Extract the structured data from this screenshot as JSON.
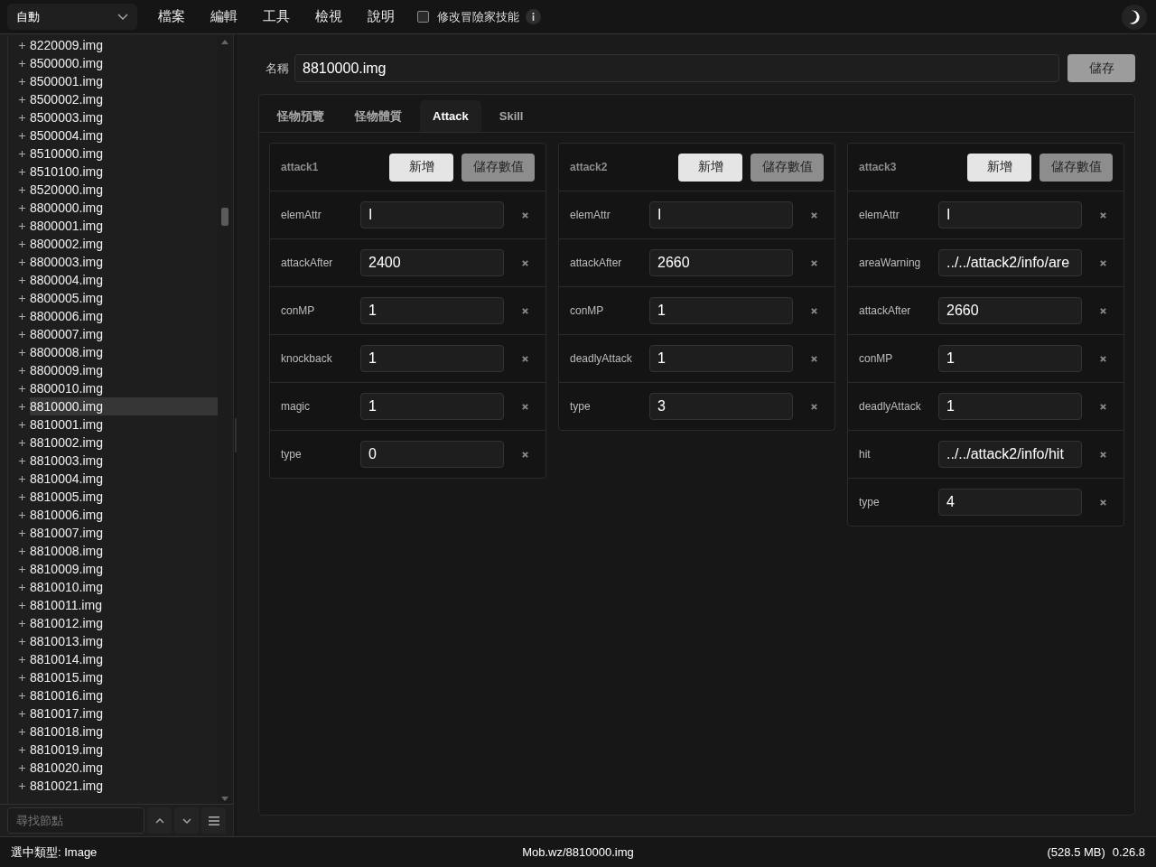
{
  "toolbar": {
    "mode_select": {
      "value": "自動"
    },
    "menu": [
      "檔案",
      "編輯",
      "工具",
      "檢視",
      "說明"
    ],
    "option": {
      "label": "修改冒險家技能",
      "checked": false
    }
  },
  "tree": {
    "items": [
      {
        "label": "8220009.img",
        "expanded": false,
        "selected": false
      },
      {
        "label": "8500000.img",
        "expanded": false,
        "selected": false
      },
      {
        "label": "8500001.img",
        "expanded": false,
        "selected": false
      },
      {
        "label": "8500002.img",
        "expanded": false,
        "selected": false
      },
      {
        "label": "8500003.img",
        "expanded": false,
        "selected": false
      },
      {
        "label": "8500004.img",
        "expanded": false,
        "selected": false
      },
      {
        "label": "8510000.img",
        "expanded": false,
        "selected": false
      },
      {
        "label": "8510100.img",
        "expanded": false,
        "selected": false
      },
      {
        "label": "8520000.img",
        "expanded": false,
        "selected": false
      },
      {
        "label": "8800000.img",
        "expanded": false,
        "selected": false
      },
      {
        "label": "8800001.img",
        "expanded": false,
        "selected": false
      },
      {
        "label": "8800002.img",
        "expanded": false,
        "selected": false
      },
      {
        "label": "8800003.img",
        "expanded": false,
        "selected": false
      },
      {
        "label": "8800004.img",
        "expanded": false,
        "selected": false
      },
      {
        "label": "8800005.img",
        "expanded": false,
        "selected": false
      },
      {
        "label": "8800006.img",
        "expanded": false,
        "selected": false
      },
      {
        "label": "8800007.img",
        "expanded": false,
        "selected": false
      },
      {
        "label": "8800008.img",
        "expanded": false,
        "selected": false
      },
      {
        "label": "8800009.img",
        "expanded": false,
        "selected": false
      },
      {
        "label": "8800010.img",
        "expanded": false,
        "selected": false
      },
      {
        "label": "8810000.img",
        "expanded": false,
        "selected": true
      },
      {
        "label": "8810001.img",
        "expanded": false,
        "selected": false
      },
      {
        "label": "8810002.img",
        "expanded": false,
        "selected": false
      },
      {
        "label": "8810003.img",
        "expanded": false,
        "selected": false
      },
      {
        "label": "8810004.img",
        "expanded": false,
        "selected": false
      },
      {
        "label": "8810005.img",
        "expanded": false,
        "selected": false
      },
      {
        "label": "8810006.img",
        "expanded": false,
        "selected": false
      },
      {
        "label": "8810007.img",
        "expanded": false,
        "selected": false
      },
      {
        "label": "8810008.img",
        "expanded": false,
        "selected": false
      },
      {
        "label": "8810009.img",
        "expanded": false,
        "selected": false
      },
      {
        "label": "8810010.img",
        "expanded": false,
        "selected": false
      },
      {
        "label": "8810011.img",
        "expanded": false,
        "selected": false
      },
      {
        "label": "8810012.img",
        "expanded": false,
        "selected": false
      },
      {
        "label": "8810013.img",
        "expanded": false,
        "selected": false
      },
      {
        "label": "8810014.img",
        "expanded": false,
        "selected": false
      },
      {
        "label": "8810015.img",
        "expanded": false,
        "selected": false
      },
      {
        "label": "8810016.img",
        "expanded": false,
        "selected": false
      },
      {
        "label": "8810017.img",
        "expanded": false,
        "selected": false
      },
      {
        "label": "8810018.img",
        "expanded": false,
        "selected": false
      },
      {
        "label": "8810019.img",
        "expanded": false,
        "selected": false
      },
      {
        "label": "8810020.img",
        "expanded": false,
        "selected": false
      },
      {
        "label": "8810021.img",
        "expanded": false,
        "selected": false
      }
    ]
  },
  "node_search": {
    "placeholder": "尋找節點"
  },
  "editor": {
    "name_label": "名稱",
    "name_value": "8810000.img",
    "save_button": {
      "label": "儲存",
      "kind": "secondary"
    },
    "tabs": [
      {
        "label": "怪物預覽",
        "selected": false
      },
      {
        "label": "怪物體質",
        "selected": false
      },
      {
        "label": "Attack",
        "selected": true
      },
      {
        "label": "Skill",
        "selected": false
      }
    ],
    "groups": [
      {
        "title": "attack1",
        "buttons": [
          {
            "label": "新增",
            "kind": "primary"
          },
          {
            "label": "儲存數值",
            "kind": "secondary"
          }
        ],
        "fields": [
          {
            "key": "elemAttr",
            "value": "I"
          },
          {
            "key": "attackAfter",
            "value": "2400"
          },
          {
            "key": "conMP",
            "value": "1"
          },
          {
            "key": "knockback",
            "value": "1"
          },
          {
            "key": "magic",
            "value": "1"
          },
          {
            "key": "type",
            "value": "0"
          }
        ]
      },
      {
        "title": "attack2",
        "buttons": [
          {
            "label": "新增",
            "kind": "primary"
          },
          {
            "label": "儲存數值",
            "kind": "secondary"
          }
        ],
        "fields": [
          {
            "key": "elemAttr",
            "value": "I"
          },
          {
            "key": "attackAfter",
            "value": "2660"
          },
          {
            "key": "conMP",
            "value": "1"
          },
          {
            "key": "deadlyAttack",
            "value": "1"
          },
          {
            "key": "type",
            "value": "3"
          }
        ]
      },
      {
        "title": "attack3",
        "buttons": [
          {
            "label": "新增",
            "kind": "primary"
          },
          {
            "label": "儲存數值",
            "kind": "secondary"
          }
        ],
        "fields": [
          {
            "key": "elemAttr",
            "value": "I"
          },
          {
            "key": "areaWarning",
            "value": "../../attack2/info/are"
          },
          {
            "key": "attackAfter",
            "value": "2660"
          },
          {
            "key": "conMP",
            "value": "1"
          },
          {
            "key": "deadlyAttack",
            "value": "1"
          },
          {
            "key": "hit",
            "value": "../../attack2/info/hit"
          },
          {
            "key": "type",
            "value": "4"
          }
        ]
      }
    ]
  },
  "status_bar": {
    "selected_type": "選中類型: Image",
    "path": "Mob.wz/8810000.img",
    "memory": "(528.5 MB)",
    "version": "0.26.8"
  }
}
